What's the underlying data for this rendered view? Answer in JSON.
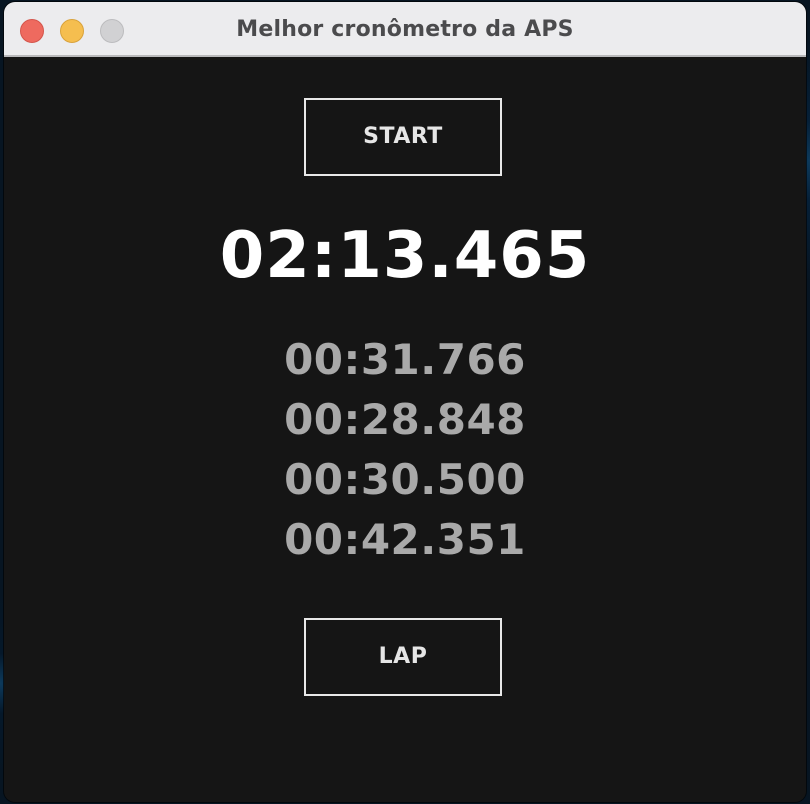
{
  "window": {
    "title": "Melhor cronômetro da APS"
  },
  "stopwatch": {
    "start_label": "START",
    "elapsed": "02:13.465",
    "laps": [
      "00:31.766",
      "00:28.848",
      "00:30.500",
      "00:42.351"
    ],
    "lap_label": "LAP"
  },
  "colors": {
    "background": "#151515",
    "main_time": "#ffffff",
    "lap_text": "#a9a9a9",
    "button_border": "#e8e8e8"
  }
}
